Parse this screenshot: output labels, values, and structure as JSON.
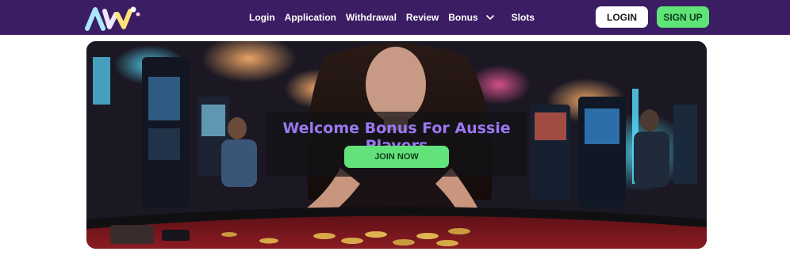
{
  "header": {
    "logo_alt": "AW logo",
    "nav": [
      {
        "label": "Login"
      },
      {
        "label": "Application"
      },
      {
        "label": "Withdrawal"
      },
      {
        "label": "Review"
      },
      {
        "label": "Bonus"
      },
      {
        "label": "Slots"
      }
    ],
    "login_label": "LOGIN",
    "signup_label": "SIGN UP"
  },
  "hero": {
    "title": "Welcome Bonus For Aussie Players",
    "cta_label": "JOIN NOW"
  },
  "colors": {
    "header_bg": "#3a1d63",
    "accent_green": "#5ee477",
    "title_purple": "#9a78f0"
  },
  "icons": {
    "logo": "brand-logo-icon",
    "bonus_dropdown": "chevron-down-icon"
  }
}
